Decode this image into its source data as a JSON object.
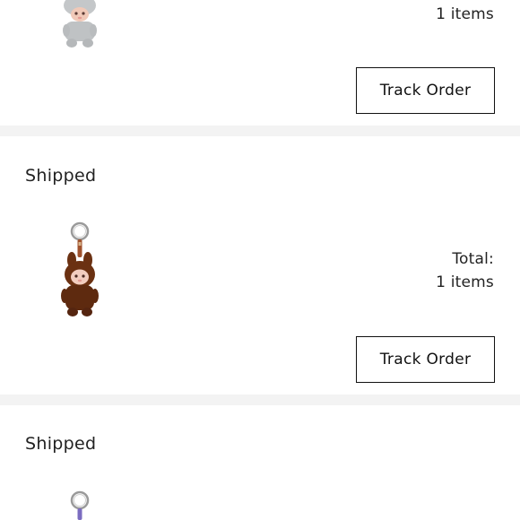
{
  "orders": [
    {
      "status": "",
      "total_label": "",
      "items_count": "1 items",
      "track_label": "Track Order",
      "product_icon": "grey-plush-doll-icon"
    },
    {
      "status": "Shipped",
      "total_label": "Total:",
      "items_count": "1 items",
      "track_label": "Track Order",
      "product_icon": "brown-plush-keychain-icon"
    },
    {
      "status": "Shipped",
      "total_label": "",
      "items_count": "",
      "track_label": "",
      "product_icon": "purple-keychain-icon"
    }
  ],
  "colors": {
    "divider": "#f3f3f3",
    "button_border": "#111111",
    "grey_doll": "#bfc2c4",
    "brown_doll": "#6b3112",
    "purple_ring": "#7b6cc0"
  }
}
